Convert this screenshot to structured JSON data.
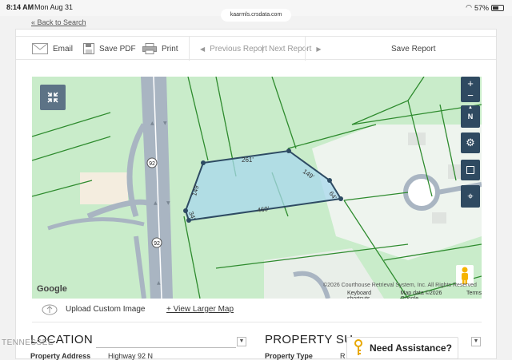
{
  "status": {
    "time": "8:14 AM",
    "date": "Mon Aug 31",
    "url": "kaarmls.crsdata.com",
    "battery": "57%",
    "battery_level": 0.57
  },
  "back_link": "« Back to Search",
  "toolbar": {
    "email": "Email",
    "save_pdf": "Save PDF",
    "print": "Print",
    "previous_report": "Previous Report",
    "separator": "|",
    "next_report": "Next Report",
    "save_report": "Save Report"
  },
  "map": {
    "highway_shield": "92",
    "dimensions": {
      "top": "261'",
      "right_upper": "149'",
      "right_lower": "64'",
      "bottom": "460'",
      "left": "149'",
      "left_lower": "34'"
    },
    "google_logo": "Google",
    "copyright": "©2026 Courthouse Retrieval System, Inc. All Rights Reserved",
    "keyboard_shortcuts": "Keyboard shortcuts",
    "map_data": "Map data ©2026 Google",
    "terms": "Terms",
    "compass": "N"
  },
  "map_footer": {
    "upload": "Upload Custom Image",
    "larger_map": "+ View Larger Map"
  },
  "sections": {
    "location": {
      "title": "LOCATION",
      "property_address_label": "Property Address",
      "property_address_value": "Highway 92 N"
    },
    "property_summary": {
      "title": "PROPERTY SU",
      "property_type_label": "Property Type",
      "property_type_value": "R"
    }
  },
  "assistance": "Need Assistance?",
  "watermark": "TENNESSEE"
}
